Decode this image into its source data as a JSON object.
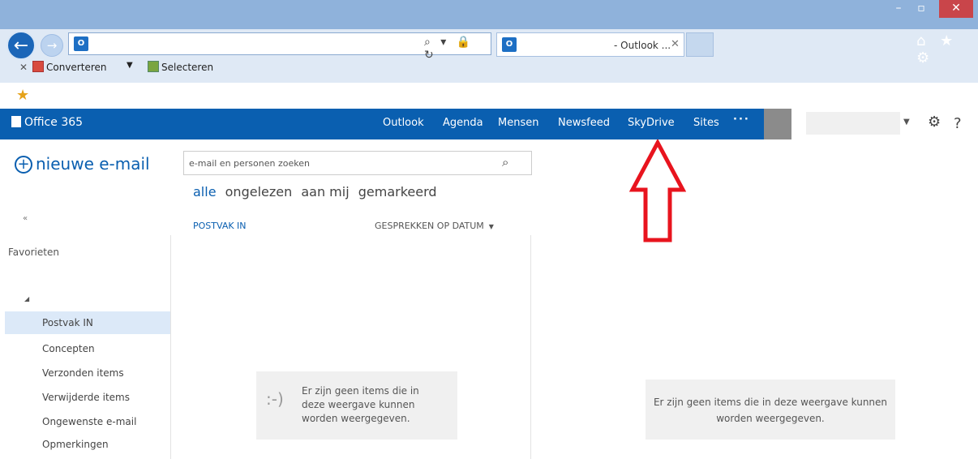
{
  "browser": {
    "window_controls": {
      "minimize": "–",
      "maximize": "▫",
      "close": "✕"
    },
    "address": {
      "value": "",
      "tools": "⌕ ▾ 🔒 ↻"
    },
    "tab": {
      "title": "- Outlook ...",
      "close": "✕",
      "icon_text": "O"
    },
    "command_bar": {
      "close": "✕",
      "convert_label": "Converteren",
      "dropdown": "▼",
      "select_label": "Selecteren"
    },
    "top_icons": "⌂ ★ ⚙"
  },
  "o365": {
    "logo_label": "Office 365",
    "nav": [
      "Outlook",
      "Agenda",
      "Mensen",
      "Newsfeed",
      "SkyDrive",
      "Sites",
      "···"
    ],
    "user_dropdown": "▼",
    "gear": "⚙",
    "help": "?"
  },
  "mail": {
    "new_mail_label": "nieuwe e-mail",
    "new_mail_plus": "+",
    "search_placeholder": "e-mail en personen zoeken",
    "search_icon": "⌕",
    "filters": [
      "alle",
      "ongelezen",
      "aan mij",
      "gemarkeerd"
    ],
    "active_filter": "alle",
    "collapse": "«",
    "inbox_title": "POSTVAK IN",
    "sort_label": "GESPREKKEN OP DATUM",
    "sort_arrow": "▼",
    "favorites_label": "Favorieten",
    "tree_toggle": "◢",
    "folders": [
      "Postvak IN",
      "Concepten",
      "Verzonden items",
      "Verwijderde items",
      "Ongewenste e-mail",
      "Opmerkingen"
    ],
    "selected_folder": "Postvak IN",
    "empty_list_smiley": ":-)",
    "empty_list_text": "Er zijn geen items die in deze weergave kunnen worden weergegeven.",
    "empty_reading_text": "Er zijn geen items die in deze weergave kunnen worden weergegeven."
  },
  "colors": {
    "brand_blue": "#0a5fb0",
    "annotation_red": "#e8141e",
    "selected_folder_bg": "#dce9f8"
  }
}
